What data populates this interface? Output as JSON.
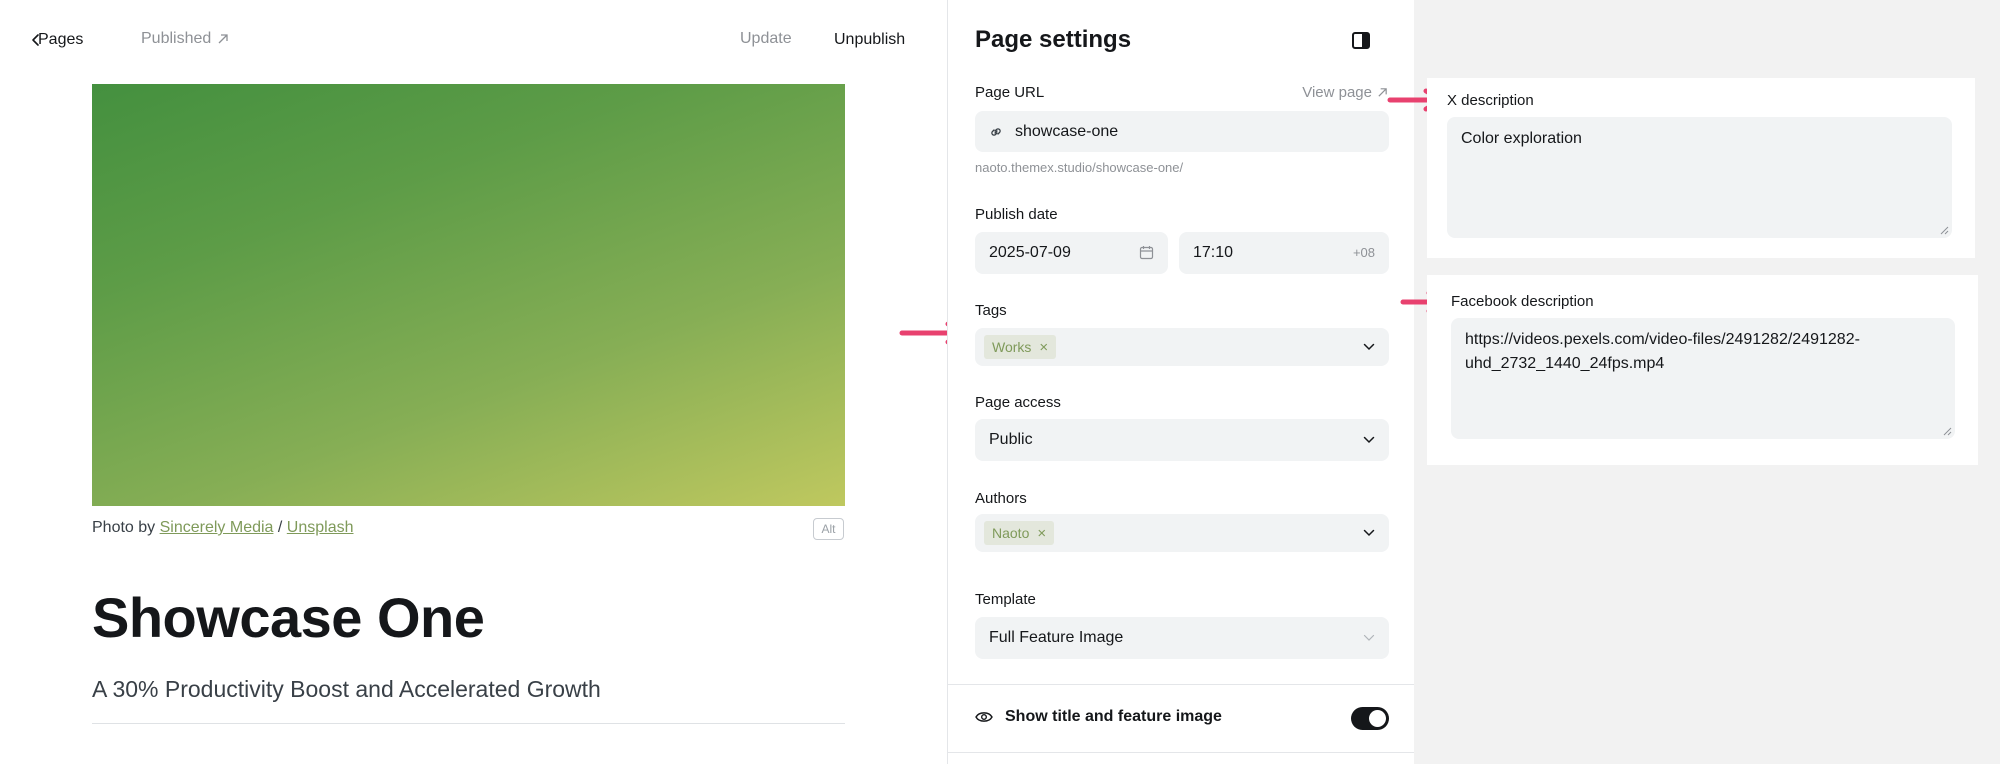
{
  "editor": {
    "back_label": "Pages",
    "status_label": "Published",
    "update_label": "Update",
    "unpublish_label": "Unpublish",
    "caption_prefix": "Photo by",
    "caption_author": "Sincerely Media",
    "caption_separator": "/",
    "caption_source": "Unsplash",
    "alt_label": "Alt",
    "title": "Showcase One",
    "excerpt": "A 30% Productivity Boost and Accelerated Growth"
  },
  "settings": {
    "title": "Page settings",
    "url_label": "Page URL",
    "view_page_label": "View page",
    "url_value": "showcase-one",
    "url_hint": "naoto.themex.studio/showcase-one/",
    "publish_date_label": "Publish date",
    "date_value": "2025-07-09",
    "time_value": "17:10",
    "timezone": "+08",
    "tags_label": "Tags",
    "tags": [
      "Works"
    ],
    "access_label": "Page access",
    "access_value": "Public",
    "authors_label": "Authors",
    "authors": [
      "Naoto"
    ],
    "template_label": "Template",
    "template_value": "Full Feature Image",
    "show_title_label": "Show title and feature image",
    "show_title_enabled": true
  },
  "social": {
    "x_label": "X description",
    "x_value": "Color exploration",
    "facebook_label": "Facebook description",
    "facebook_value": "https://videos.pexels.com/video-files/2491282/2491282-uhd_2732_1440_24fps.mp4"
  },
  "colors": {
    "accent_arrow": "#e8416f",
    "token_bg": "#e3e7dc",
    "token_text": "#7f9a5a"
  }
}
